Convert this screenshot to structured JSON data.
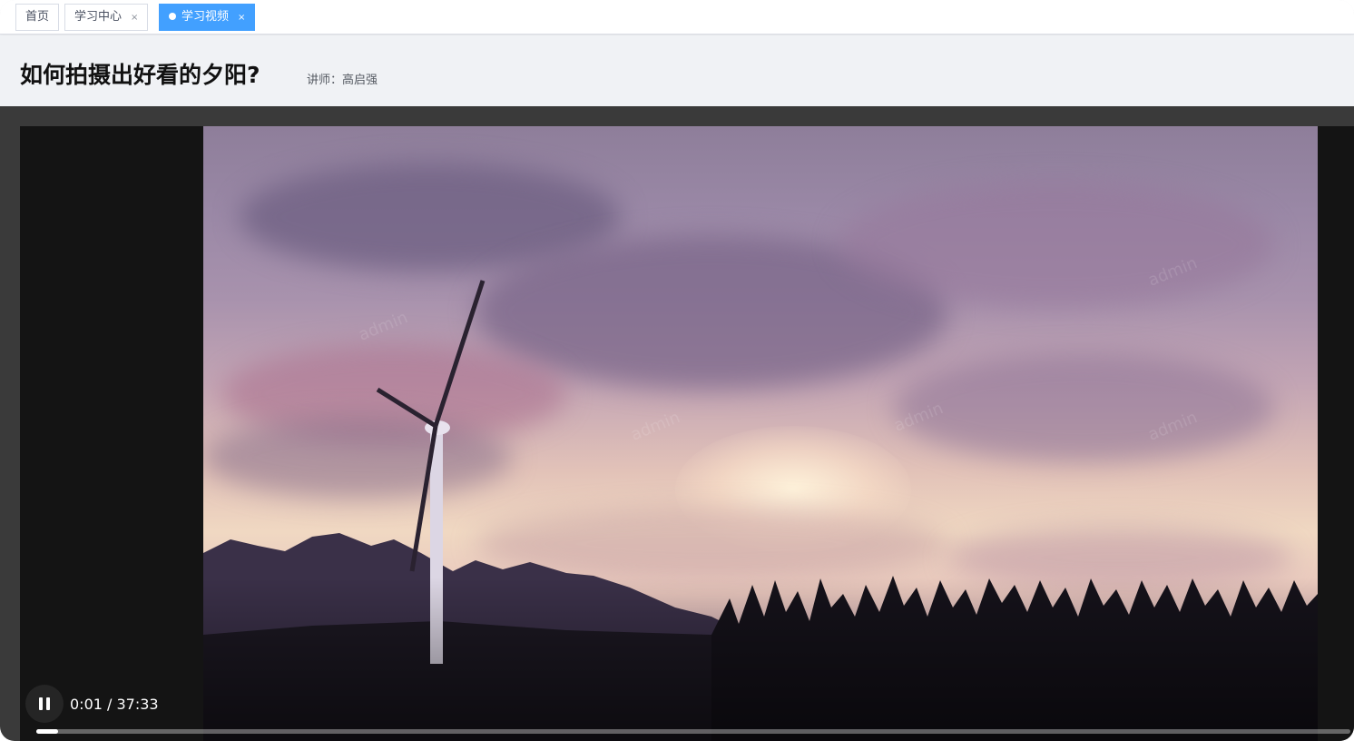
{
  "tabs": [
    {
      "label": "首页",
      "closable": false,
      "active": false
    },
    {
      "label": "学习中心",
      "closable": true,
      "active": false
    },
    {
      "label": "学习视频",
      "closable": true,
      "active": true
    }
  ],
  "tab_close_glyph": "×",
  "page": {
    "title": "如何拍摄出好看的夕阳?",
    "teacher": "讲师：高启强"
  },
  "player": {
    "state": "playing",
    "current_time": "0:01",
    "separator": "/",
    "duration": "37:33",
    "time_text": "0:01 / 37:33",
    "progress_fraction": 0.0004,
    "watermark": "admin"
  },
  "colors": {
    "tab_active": "#42a0ff",
    "header_bg": "#f0f2f5",
    "player_bg": "#3a3a3a"
  },
  "icons": {
    "pause": "pause-icon",
    "close": "close-icon",
    "active_dot": "dot-icon"
  }
}
